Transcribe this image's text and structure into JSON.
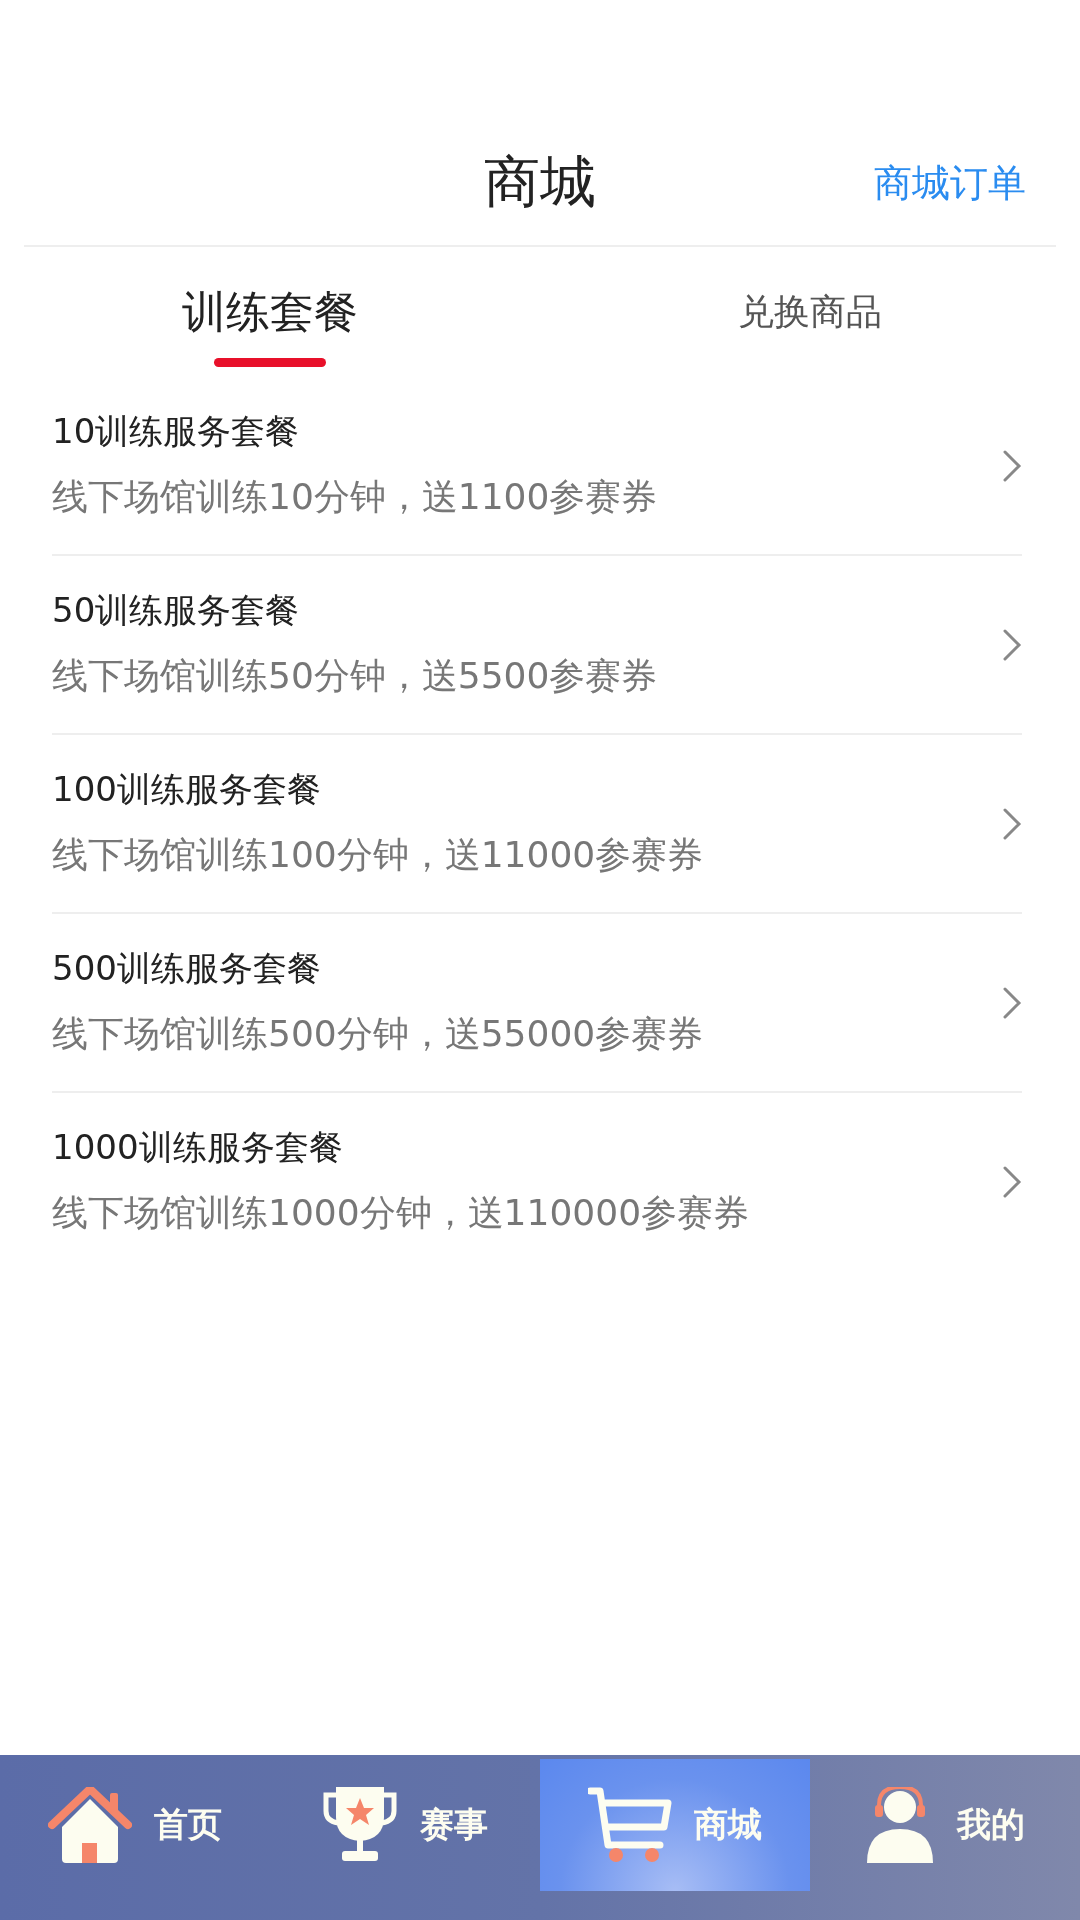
{
  "header": {
    "title": "商城",
    "action": "商城订单"
  },
  "tabs": [
    {
      "label": "训练套餐",
      "selected": true
    },
    {
      "label": "兑换商品",
      "selected": false
    }
  ],
  "packages": [
    {
      "title": "10训练服务套餐",
      "description": "线下场馆训练10分钟，送1100参赛券"
    },
    {
      "title": "50训练服务套餐",
      "description": "线下场馆训练50分钟，送5500参赛券"
    },
    {
      "title": "100训练服务套餐",
      "description": "线下场馆训练100分钟，送11000参赛券"
    },
    {
      "title": "500训练服务套餐",
      "description": "线下场馆训练500分钟，送55000参赛券"
    },
    {
      "title": "1000训练服务套餐",
      "description": "线下场馆训练1000分钟，送110000参赛券"
    }
  ],
  "bottom_nav": [
    {
      "kind": "home",
      "label": "首页",
      "selected": false
    },
    {
      "kind": "trophy",
      "label": "赛事",
      "selected": false
    },
    {
      "kind": "cart",
      "label": "商城",
      "selected": true
    },
    {
      "kind": "user",
      "label": "我的",
      "selected": false
    }
  ]
}
